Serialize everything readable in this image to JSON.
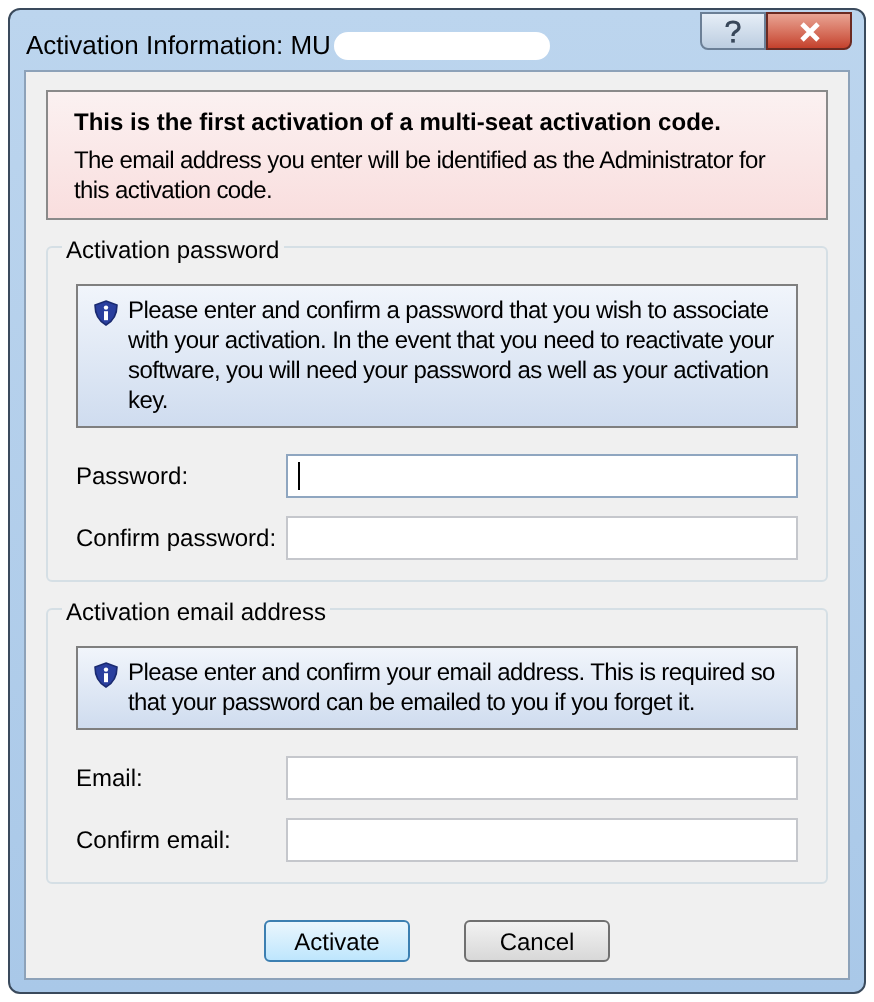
{
  "window": {
    "title": "Activation Information: MU",
    "title_redacted": true
  },
  "notice": {
    "heading": "This is the first activation of a multi-seat activation code.",
    "body": "The email address you enter will be identified as the Administrator for this activation code."
  },
  "groups": [
    {
      "title": "Activation password",
      "info": "Please enter and confirm a password that you wish to associate with your activation. In the event that you need to reactivate your software, you will need your password as well as your activation key.",
      "fields": [
        {
          "label": "Password:",
          "focused": true
        },
        {
          "label": "Confirm password:",
          "focused": false
        }
      ]
    },
    {
      "title": "Activation email address",
      "info": "Please enter and confirm your email address. This is required so that your password can be emailed to you if you forget it.",
      "fields": [
        {
          "label": "Email:",
          "focused": false
        },
        {
          "label": "Confirm email:",
          "focused": false
        }
      ]
    }
  ],
  "buttons": [
    {
      "label": "Activate",
      "default": true
    },
    {
      "label": "Cancel",
      "default": false
    }
  ]
}
